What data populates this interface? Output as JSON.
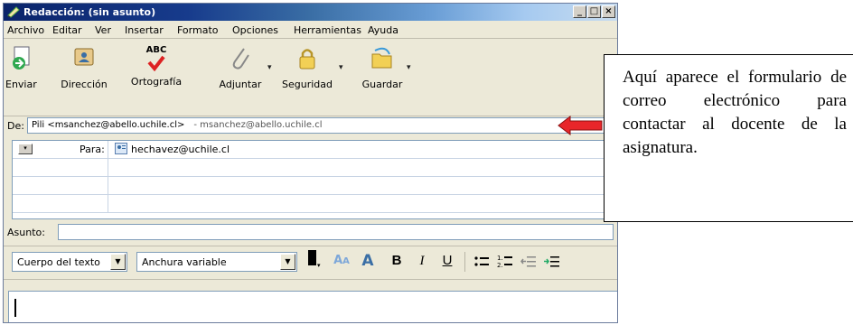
{
  "window": {
    "title": "Redacción: (sin asunto)"
  },
  "title_buttons": [
    "_",
    "□",
    "×"
  ],
  "menu": [
    "Archivo",
    "Editar",
    "Ver",
    "Insertar",
    "Formato",
    "Opciones",
    "Herramientas",
    "Ayuda"
  ],
  "toolbar": {
    "send": "Enviar",
    "address": "Dirección",
    "spelling": "Ortografía",
    "spelling_glyph": "ABC",
    "attach": "Adjuntar",
    "security": "Seguridad",
    "save": "Guardar"
  },
  "from": {
    "label": "De:",
    "value": "Pili <msanchez@abello.uchile.cl>",
    "sub": "- msanchez@abello.uchile.cl"
  },
  "recipients": [
    {
      "type": "Para:",
      "address": "hechavez@uchile.cl"
    }
  ],
  "subject": {
    "label": "Asunto:",
    "value": ""
  },
  "format": {
    "paragraph_style": "Cuerpo del texto",
    "font": "Anchura variable",
    "icons": [
      "font-color",
      "decrease-font-size",
      "increase-font-size",
      "bold",
      "italic",
      "underline",
      "bullet-list",
      "numbered-list",
      "decrease-indent",
      "increase-indent"
    ],
    "bold": "B",
    "italic": "I",
    "underline": "U"
  },
  "callout": {
    "text": "Aquí aparece el formulario de correo electrónico para contactar al docente de la asignatura."
  },
  "colors": {
    "arrow": "#e8262a",
    "title_start": "#0a246a",
    "title_end": "#c8dcef"
  }
}
